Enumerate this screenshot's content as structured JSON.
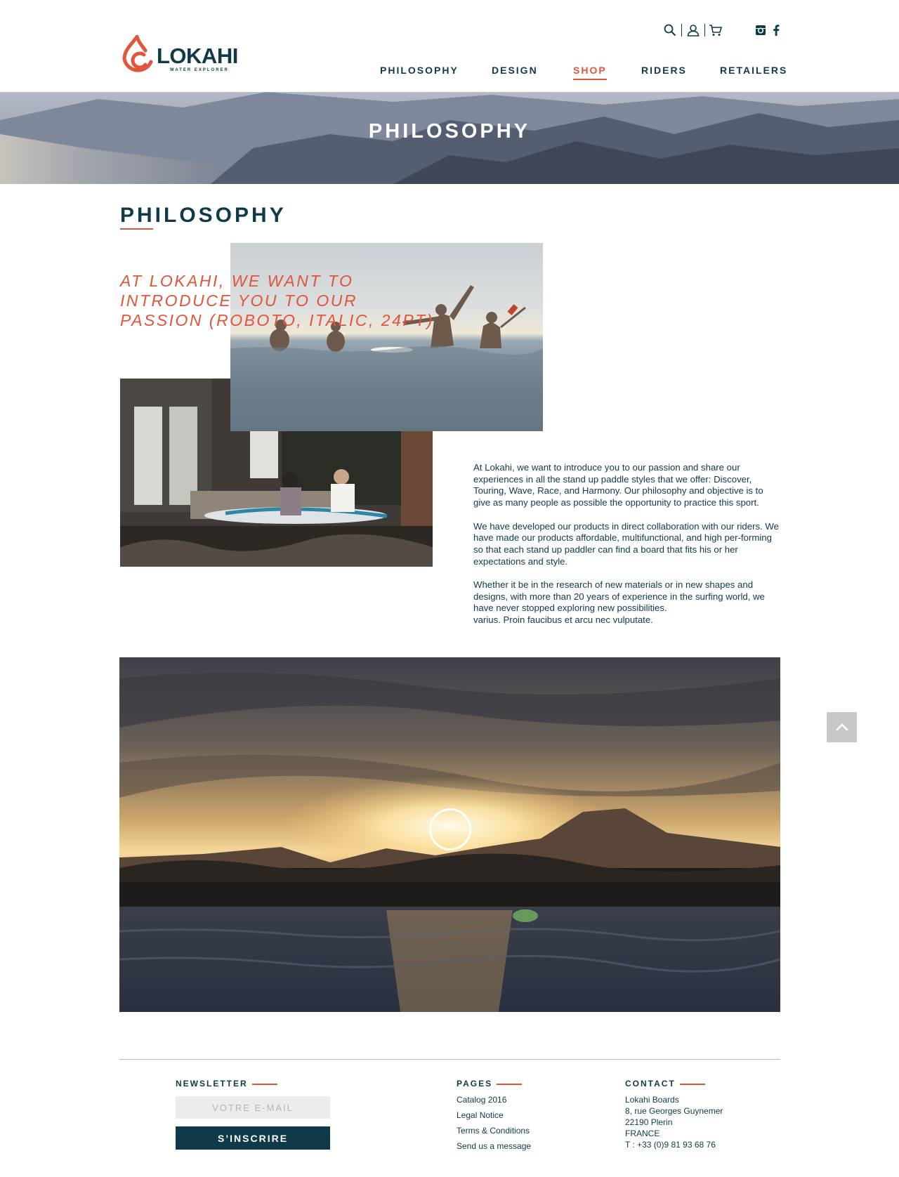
{
  "brand": {
    "name": "LOKAHI",
    "tagline": "WATER EXPLORER",
    "accent": "#e2553a",
    "navy": "#0e3a4a"
  },
  "header": {
    "utility_icons": [
      "search-icon",
      "user-icon",
      "cart-icon",
      "instagram-icon",
      "facebook-icon"
    ],
    "nav": [
      {
        "label": "PHILOSOPHY",
        "active": false
      },
      {
        "label": "DESIGN",
        "active": false
      },
      {
        "label": "SHOP",
        "active": true
      },
      {
        "label": "RIDERS",
        "active": false
      },
      {
        "label": "RETAILERS",
        "active": false
      }
    ]
  },
  "hero": {
    "title": "PHILOSOPHY"
  },
  "main": {
    "title": "PHILOSOPHY",
    "quote_lines": [
      "AT LOKAHI, WE WANT TO",
      "INTRODUCE YOU TO OUR",
      "PASSION (ROBOTO, ITALIC, 24PT)"
    ],
    "paragraphs": [
      "At Lokahi, we want to introduce you to our passion and share our experiences in all the stand up paddle styles that we offer: Discover, Touring, Wave, Race, and Harmony. Our philosophy and objective is to give as many people as possible the opportunity to practice this sport.",
      "We have developed our products in direct collaboration with our riders. We have made our products affordable, multifunctional, and high per-forming so that each stand up paddler can find a board that fits his or her expectations and style.",
      "Whether it be in the research of new materials or in new shapes and designs, with more than 20 years of experience in the surfing world, we have never stopped exploring new possibilities.",
      "varius. Proin faucibus et arcu nec vulputate."
    ]
  },
  "footer": {
    "newsletter": {
      "heading": "NEWSLETTER",
      "placeholder": "VOTRE E-MAIL",
      "button": "S’INSCRIRE"
    },
    "pages": {
      "heading": "PAGES",
      "links": [
        "Catalog 2016",
        "Legal Notice",
        "Terms & Conditions",
        "Send us a message"
      ]
    },
    "contact": {
      "heading": "CONTACT",
      "lines": [
        "Lokahi Boards",
        "8, rue Georges Guynemer",
        "22190 Plerin",
        "FRANCE",
        "T : +33 (0)9 81 93 68 76"
      ]
    }
  }
}
